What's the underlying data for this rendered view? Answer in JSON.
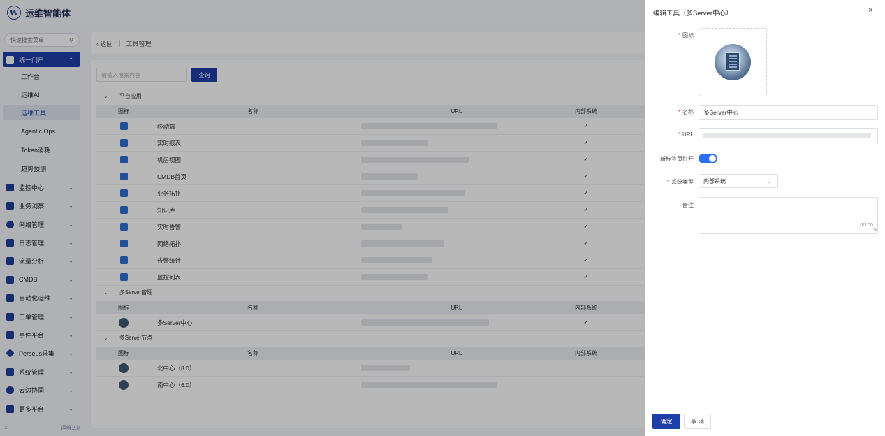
{
  "app": {
    "logo_letter": "W",
    "title": "运维智能体"
  },
  "sidebar": {
    "search_placeholder": "快速搜索菜单",
    "groups": [
      {
        "label": "统一门户",
        "icon": "portal-icon",
        "expanded": true,
        "children": [
          "工作台",
          "运维AI",
          "运维工具",
          "Agentic Ops",
          "Token消耗",
          "趋势预测"
        ],
        "selected_child": "运维工具"
      },
      {
        "label": "监控中心",
        "icon": "monitor-icon"
      },
      {
        "label": "业务洞察",
        "icon": "insight-icon"
      },
      {
        "label": "网络管理",
        "icon": "globe-icon"
      },
      {
        "label": "日志管理",
        "icon": "log-icon"
      },
      {
        "label": "流量分析",
        "icon": "traffic-icon"
      },
      {
        "label": "CMDB",
        "icon": "cmdb-icon"
      },
      {
        "label": "自动化运维",
        "icon": "gear-icon"
      },
      {
        "label": "工单管理",
        "icon": "ticket-icon"
      },
      {
        "label": "事件平台",
        "icon": "bell-icon"
      },
      {
        "label": "Perseus采集",
        "icon": "diamond-icon"
      },
      {
        "label": "系统管理",
        "icon": "settings-icon"
      },
      {
        "label": "云边协同",
        "icon": "cloud-icon"
      },
      {
        "label": "更多平台",
        "icon": "grid-icon"
      }
    ],
    "collapse_label": "运维2.0"
  },
  "breadcrumb": {
    "back": "返回",
    "current": "工具管理"
  },
  "toolbar": {
    "search_placeholder": "请输入搜索内容",
    "query_label": "查询"
  },
  "table_headers": {
    "icon": "图标",
    "name": "名称",
    "url": "URL",
    "internal": "内部系统"
  },
  "groups": [
    {
      "title": "平台应用",
      "rows": [
        {
          "name": "移动端",
          "internal": "✓",
          "url_width": 0.67
        },
        {
          "name": "实时报表",
          "internal": "✓",
          "url_width": 0.33
        },
        {
          "name": "机房视图",
          "internal": "✓",
          "url_width": 0.53
        },
        {
          "name": "CMDB首页",
          "internal": "✓",
          "url_width": 0.28
        },
        {
          "name": "业务拓扑",
          "internal": "✓",
          "url_width": 0.51
        },
        {
          "name": "知识库",
          "internal": "✓",
          "url_width": 0.43
        },
        {
          "name": "实时告警",
          "internal": "✓",
          "url_width": 0.2
        },
        {
          "name": "网络拓扑",
          "internal": "✓",
          "url_width": 0.41
        },
        {
          "name": "告警统计",
          "internal": "✓",
          "url_width": 0.35
        },
        {
          "name": "监控列表",
          "internal": "✓",
          "url_width": 0.33
        }
      ]
    },
    {
      "title": "多Server管理",
      "rows": [
        {
          "name": "多Server中心",
          "internal": "✓",
          "url_width": 0.63
        }
      ]
    },
    {
      "title": "多Server节点",
      "rows": [
        {
          "name": "北中心（8.0）",
          "internal": "",
          "url_width": 0.24
        },
        {
          "name": "南中心（6.0）",
          "internal": "",
          "url_width": 0.67
        }
      ]
    }
  ],
  "drawer": {
    "title": "编辑工具（多Server中心）",
    "close": "×",
    "labels": {
      "icon": "图标",
      "name": "名称",
      "url": "URL",
      "new_tab": "新标签页打开",
      "system_type": "系统类型",
      "remark": "备注"
    },
    "values": {
      "name": "多Server中心",
      "new_tab_on": true,
      "system_type": "内部系统",
      "remark_count": "0/100"
    },
    "ok_label": "确定",
    "cancel_label": "取 消"
  },
  "colors": {
    "primary": "#1e3ea8",
    "toggle_on": "#2c6ff0",
    "required": "#e04545"
  }
}
